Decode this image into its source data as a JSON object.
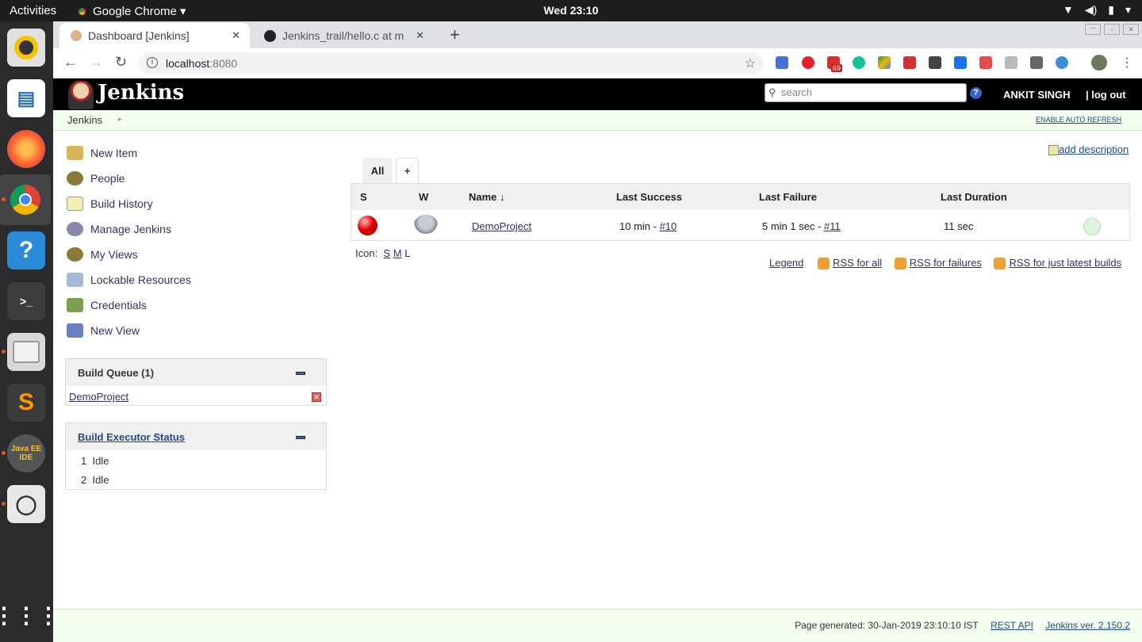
{
  "topbar": {
    "activities": "Activities",
    "app": "Google Chrome ▾",
    "clock": "Wed 23:10"
  },
  "browser": {
    "tab1": "Dashboard [Jenkins]",
    "tab2": "Jenkins_trail/hello.c at m",
    "url_host": "localhost",
    "url_port": ":8080",
    "gmail_badge": "69"
  },
  "jenkins": {
    "logo": "Jenkins",
    "search_placeholder": "search",
    "help": "?",
    "user": "ANKIT SINGH",
    "logout": "| log out",
    "breadcrumb": "Jenkins",
    "auto_refresh": "ENABLE AUTO REFRESH",
    "sidebar": [
      {
        "label": "New Item"
      },
      {
        "label": "People"
      },
      {
        "label": "Build History"
      },
      {
        "label": "Manage Jenkins"
      },
      {
        "label": "My Views"
      },
      {
        "label": "Lockable Resources"
      },
      {
        "label": "Credentials"
      },
      {
        "label": "New View"
      }
    ],
    "build_queue": {
      "title": "Build Queue (1)",
      "item": "DemoProject"
    },
    "executor": {
      "title": "Build Executor Status",
      "rows": [
        {
          "num": "1",
          "status": "Idle"
        },
        {
          "num": "2",
          "status": "Idle"
        }
      ]
    },
    "add_description": "add description",
    "view_tabs": {
      "all": "All",
      "add": "+"
    },
    "table": {
      "headers": {
        "s": "S",
        "w": "W",
        "name": "Name ↓",
        "last_success": "Last Success",
        "last_failure": "Last Failure",
        "last_duration": "Last Duration"
      },
      "row": {
        "name": "DemoProject",
        "ls_text": "10 min - ",
        "ls_link": "#10",
        "lf_text": "5 min 1 sec - ",
        "lf_link": "#11",
        "duration": "11 sec"
      }
    },
    "icon_label": "Icon:",
    "icon_s": "S",
    "icon_m": "M",
    "icon_l": "L",
    "legend": "Legend",
    "rss_all": "RSS for all",
    "rss_failures": "RSS for failures",
    "rss_latest": "RSS for just latest builds",
    "footer": {
      "generated": "Page generated: 30-Jan-2019 23:10:10 IST",
      "rest": "REST API",
      "version": "Jenkins ver. 2.150.2"
    }
  }
}
